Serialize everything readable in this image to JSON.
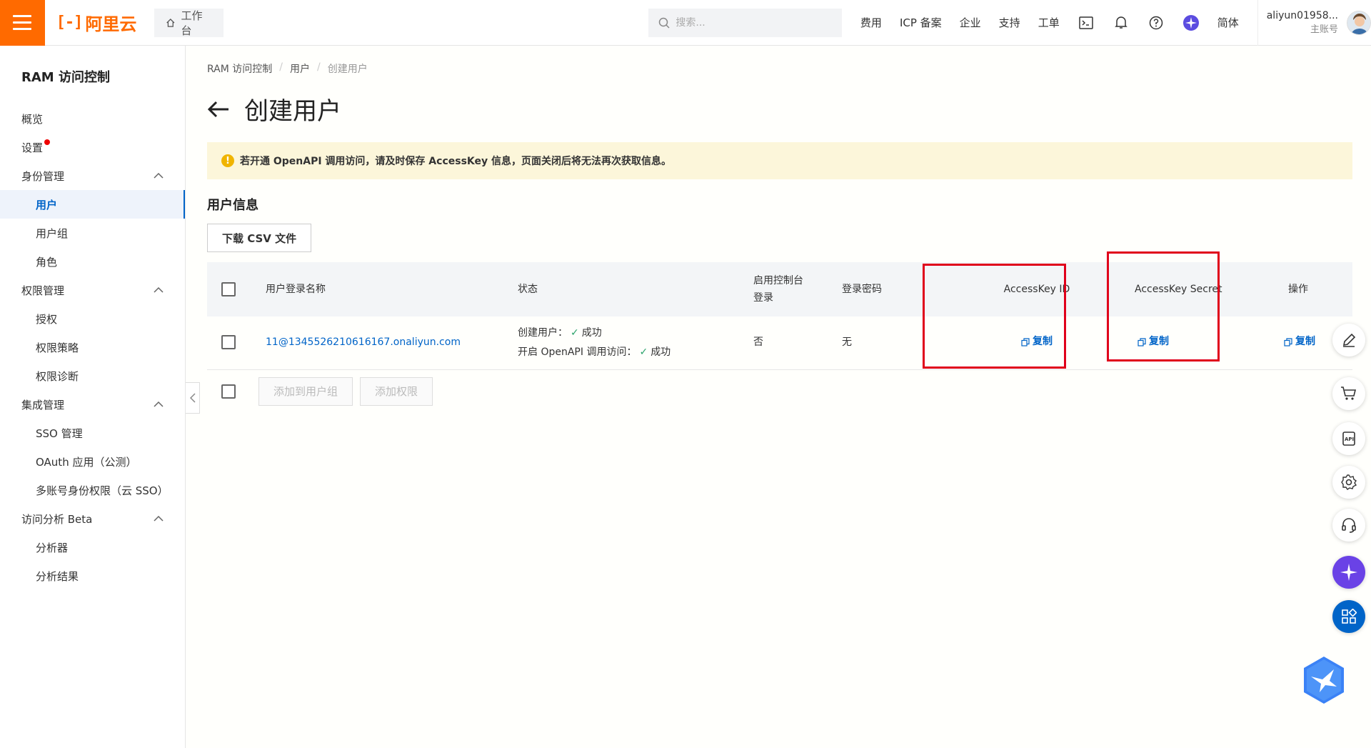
{
  "topbar": {
    "logo_mark": "[-]",
    "logo_text": "阿里云",
    "workbench_label": "工作台",
    "search_placeholder": "搜索...",
    "nav": [
      "费用",
      "ICP 备案",
      "企业",
      "支持",
      "工单"
    ],
    "lang": "简体",
    "user_name": "aliyun01958...",
    "user_role": "主账号"
  },
  "sidebar": {
    "title": "RAM 访问控制",
    "overview": "概览",
    "settings": "设置",
    "identity": {
      "label": "身份管理",
      "items": [
        "用户",
        "用户组",
        "角色"
      ]
    },
    "permission": {
      "label": "权限管理",
      "items": [
        "授权",
        "权限策略",
        "权限诊断"
      ]
    },
    "integration": {
      "label": "集成管理",
      "items": [
        "SSO 管理",
        "OAuth 应用（公测）",
        "多账号身份权限（云 SSO）"
      ]
    },
    "analysis": {
      "label": "访问分析 Beta",
      "items": [
        "分析器",
        "分析结果"
      ]
    }
  },
  "breadcrumb": [
    "RAM 访问控制",
    "用户",
    "创建用户"
  ],
  "page_title": "创建用户",
  "alert": "若开通 OpenAPI 调用访问，请及时保存 AccessKey 信息，页面关闭后将无法再次获取信息。",
  "section_title": "用户信息",
  "download_csv": "下载 CSV 文件",
  "table": {
    "headers": {
      "login_name": "用户登录名称",
      "status": "状态",
      "console_login": "启用控制台登录",
      "password": "登录密码",
      "ak_id": "AccessKey ID",
      "ak_secret": "AccessKey Secret",
      "ops": "操作"
    },
    "row": {
      "login_name": "11@1345526210616167.onaliyun.com",
      "status_create_label": "创建用户：",
      "status_create_value": "成功",
      "status_api_label": "开启 OpenAPI 调用访问：",
      "status_api_value": "成功",
      "console_login": "否",
      "password": "无",
      "copy": "复制"
    }
  },
  "footer": {
    "add_to_group": "添加到用户组",
    "add_permission": "添加权限"
  },
  "colors": {
    "brand": "#ff6a00",
    "link": "#0064c8",
    "highlight": "#e0001b",
    "alert_bg": "#fcf6da",
    "success": "#2ba36a"
  }
}
